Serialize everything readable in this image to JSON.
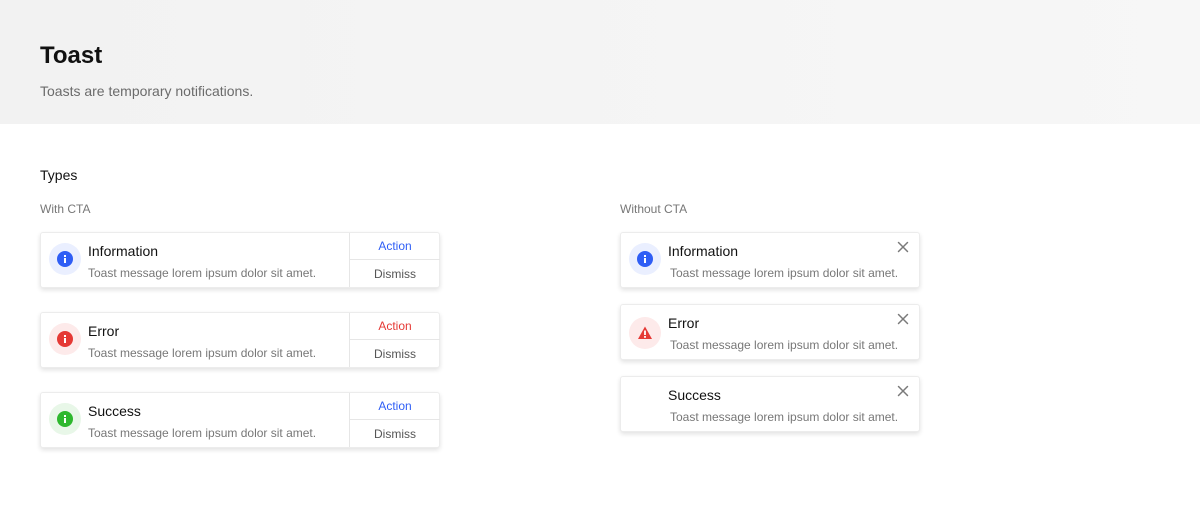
{
  "header": {
    "title": "Toast",
    "subtitle": "Toasts are temporary notifications."
  },
  "section": {
    "title": "Types"
  },
  "with_cta": {
    "label": "With CTA",
    "toasts": [
      {
        "title": "Information",
        "message": "Toast message lorem ipsum dolor sit amet.",
        "action_label": "Action",
        "dismiss_label": "Dismiss",
        "icon": "info-icon",
        "color": "#2f5ef5",
        "action_color": "#2f5ef5",
        "icon_bg": "#eaefff"
      },
      {
        "title": "Error",
        "message": "Toast message lorem ipsum dolor sit amet.",
        "action_label": "Action",
        "dismiss_label": "Dismiss",
        "icon": "error-icon",
        "color": "#e53935",
        "action_color": "#e53935",
        "icon_bg": "#fdeaea"
      },
      {
        "title": "Success",
        "message": "Toast message lorem ipsum dolor sit amet.",
        "action_label": "Action",
        "dismiss_label": "Dismiss",
        "icon": "success-icon",
        "color": "#2eb82e",
        "action_color": "#2f5ef5",
        "icon_bg": "#e8f7e8"
      }
    ]
  },
  "without_cta": {
    "label": "Without CTA",
    "toasts": [
      {
        "title": "Information",
        "message": "Toast message lorem ipsum dolor sit amet.",
        "icon": "info-icon",
        "color": "#2f5ef5",
        "icon_bg": "#eaefff"
      },
      {
        "title": "Error",
        "message": "Toast message lorem ipsum dolor sit amet.",
        "icon": "warning-icon",
        "color": "#e53935",
        "icon_bg": "#fdeaea"
      },
      {
        "title": "Success",
        "message": "Toast message lorem ipsum dolor sit amet.",
        "icon": "",
        "color": "#2eb82e",
        "icon_bg": "transparent"
      }
    ]
  }
}
